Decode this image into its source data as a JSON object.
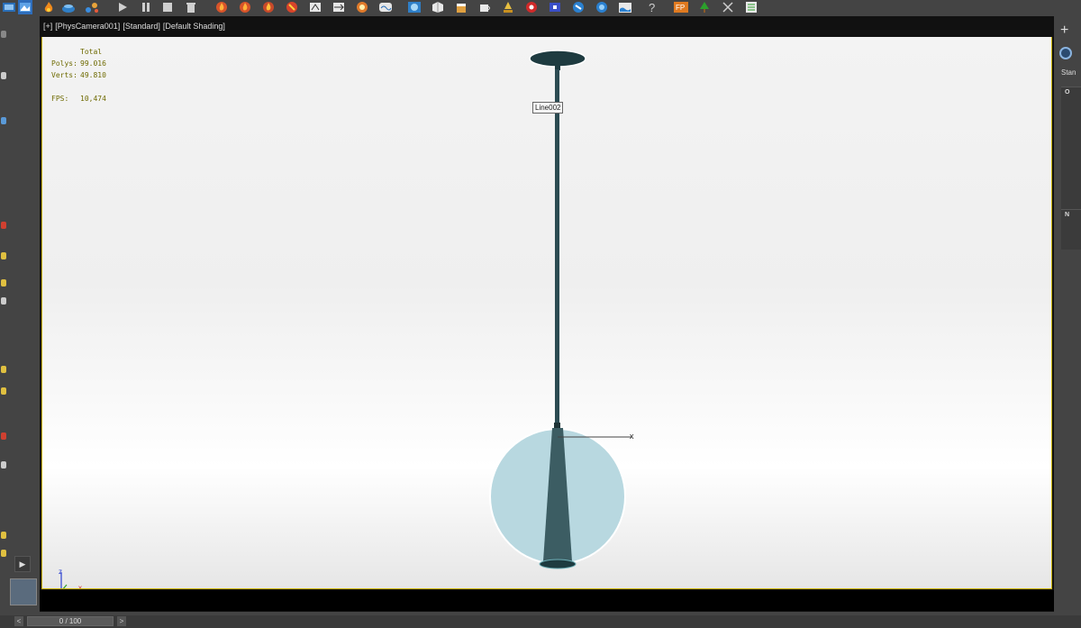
{
  "viewport": {
    "menu_label": "[+]",
    "camera_label": "[PhysCamera001]",
    "mode_label": "[Standard]",
    "shading_label": "[Default Shading]"
  },
  "stats": {
    "header": "Total",
    "polys_label": "Polys:",
    "polys_value": "99.016",
    "verts_label": "Verts:",
    "verts_value": "49.810",
    "fps_label": "FPS:",
    "fps_value": "10,474"
  },
  "scene": {
    "object_name": "Line002",
    "gizmo_axis_label": "x",
    "tripod_z_label": "z",
    "tripod_x_label": "x",
    "globe_color": "#b8d8e0",
    "pole_color": "#2c4b52"
  },
  "timeline": {
    "prev_label": "<",
    "slider_label": "0 / 100",
    "next_label": ">"
  },
  "command_panel": {
    "create_label": "+",
    "category_label": "Stan",
    "rollout1_label": "O",
    "rollout2_label": "N"
  },
  "toolbar_icons": [
    "render-setup-icon",
    "rendered-frame-icon",
    "teapot-icon",
    "play-icon",
    "pause-icon",
    "stop-icon",
    "trash-icon",
    "fire-icon",
    "fire-icon",
    "fire-icon",
    "fire-icon",
    "particle-icon",
    "flow-icon",
    "fire-icon",
    "wave-icon",
    "material-icon",
    "cube-icon",
    "cup-icon",
    "liquid-icon",
    "drop-icon",
    "sphere-icon",
    "disc-icon",
    "cloth-icon",
    "foam-icon",
    "fluid-icon",
    "help-icon",
    "fp-icon",
    "tree-icon",
    "scissors-icon",
    "list-icon"
  ]
}
